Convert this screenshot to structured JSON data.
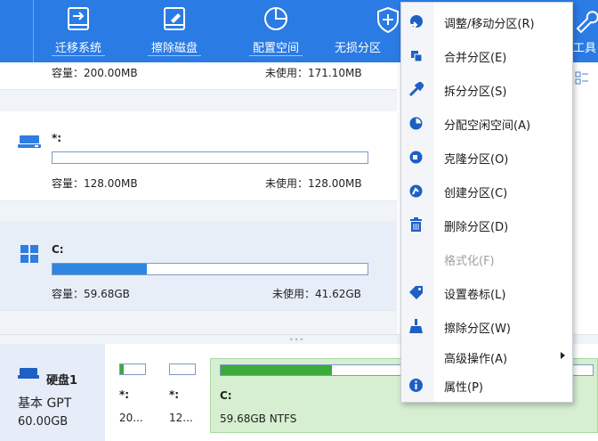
{
  "toolbar": {
    "items": [
      {
        "label": "迁移系统",
        "icon": "migrate-icon"
      },
      {
        "label": "擦除磁盘",
        "icon": "wipe-disk-icon"
      },
      {
        "label": "配置空间",
        "icon": "allocate-space-icon"
      },
      {
        "label": "无损分区",
        "icon": "lossless-partition-icon"
      },
      {
        "label": "工具",
        "icon": "tools-icon"
      }
    ]
  },
  "partitions": [
    {
      "name": "",
      "capacity": "容量：200.00MB",
      "unused": "未使用：171.10MB"
    },
    {
      "name": "*:",
      "capacity": "容量：128.00MB",
      "unused": "未使用：128.00MB",
      "used_fraction": 0.0
    },
    {
      "name": "C:",
      "capacity": "容量：59.68GB",
      "unused": "未使用：41.62GB",
      "used_fraction": 0.3
    }
  ],
  "disk": {
    "name": "硬盘1",
    "type": "基本 GPT",
    "size": "60.00GB",
    "parts": [
      {
        "label": "*:",
        "size": "20...",
        "used_fraction": 0.15
      },
      {
        "label": "*:",
        "size": "12...",
        "used_fraction": 0.0
      },
      {
        "label": "C:",
        "size": "59.68GB NTFS",
        "used_fraction": 0.3
      }
    ]
  },
  "menu": {
    "items": [
      {
        "label": "调整/移动分区(R)",
        "icon": "resize-move-icon",
        "enabled": true
      },
      {
        "label": "合并分区(E)",
        "icon": "merge-icon",
        "enabled": true
      },
      {
        "label": "拆分分区(S)",
        "icon": "split-icon",
        "enabled": true
      },
      {
        "label": "分配空闲空间(A)",
        "icon": "allocate-free-icon",
        "enabled": true
      },
      {
        "label": "克隆分区(O)",
        "icon": "clone-icon",
        "enabled": true
      },
      {
        "label": "创建分区(C)",
        "icon": "create-icon",
        "enabled": true
      },
      {
        "label": "删除分区(D)",
        "icon": "trash-icon",
        "enabled": true
      },
      {
        "label": "格式化(F)",
        "icon": "",
        "enabled": false
      },
      {
        "label": "设置卷标(L)",
        "icon": "tag-icon",
        "enabled": true
      },
      {
        "label": "擦除分区(W)",
        "icon": "wipe-icon",
        "enabled": true
      },
      {
        "label": "高级操作(A)",
        "icon": "",
        "enabled": true,
        "submenu": true
      },
      {
        "label": "属性(P)",
        "icon": "info-icon",
        "enabled": true
      }
    ]
  },
  "colors": {
    "accent": "#2a7be4",
    "used_bar": "#2f86e0",
    "disk_used": "#3aaa3a",
    "selected_partition": "#d6efd0"
  }
}
